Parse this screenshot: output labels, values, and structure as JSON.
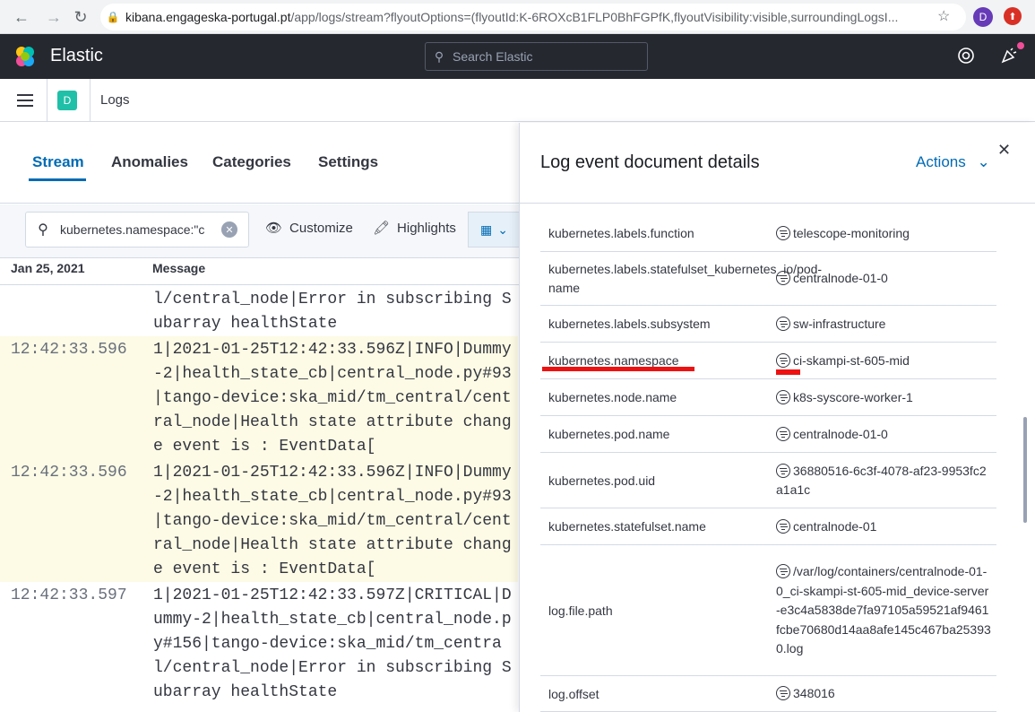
{
  "browser": {
    "url_host": "kibana.engageska-portugal.pt",
    "url_rest": "/app/logs/stream?flyoutOptions=(flyoutId:K-6ROXcB1FLP0BhFGPfK,flyoutVisibility:visible,surroundingLogsI...",
    "profile_initial": "D"
  },
  "header": {
    "brand": "Elastic",
    "search_placeholder": "Search Elastic"
  },
  "appbar": {
    "space_initial": "D",
    "breadcrumb": "Logs"
  },
  "tabs": [
    {
      "label": "Stream",
      "active": true
    },
    {
      "label": "Anomalies"
    },
    {
      "label": "Categories"
    },
    {
      "label": "Settings"
    }
  ],
  "toolbar": {
    "query": "kubernetes.namespace:\"c",
    "customize": "Customize",
    "highlights": "Highlights"
  },
  "columns": {
    "date": "Jan 25, 2021",
    "message": "Message"
  },
  "stream": [
    {
      "ts": "",
      "msg": "l/central_node|Error in subscribing S\nubarray healthState",
      "hl": false
    },
    {
      "ts": "12:42:33.596",
      "msg": "1|2021-01-25T12:42:33.596Z|INFO|Dummy\n-2|health_state_cb|central_node.py#93\n|tango-device:ska_mid/tm_central/cent\nral_node|Health state attribute chang\ne event is : EventData[",
      "hl": true
    },
    {
      "ts": "12:42:33.596",
      "msg": "1|2021-01-25T12:42:33.596Z|INFO|Dummy\n-2|health_state_cb|central_node.py#93\n|tango-device:ska_mid/tm_central/cent\nral_node|Health state attribute chang\ne event is : EventData[",
      "hl": true
    },
    {
      "ts": "12:42:33.597",
      "msg": "1|2021-01-25T12:42:33.597Z|CRITICAL|D\nummy-2|health_state_cb|central_node.p\ny#156|tango-device:ska_mid/tm_centra\nl/central_node|Error in subscribing S\nubarray healthState",
      "hl": false
    }
  ],
  "flyout": {
    "title": "Log event document details",
    "actions": "Actions",
    "fields": [
      {
        "key": "kubernetes.labels.function",
        "value": "telescope-monitoring"
      },
      {
        "key": "kubernetes.labels.statefulset_kubernetes_io/pod-name",
        "value": "centralnode-01-0"
      },
      {
        "key": "kubernetes.labels.subsystem",
        "value": "sw-infrastructure"
      },
      {
        "key": "kubernetes.namespace",
        "value": "ci-skampi-st-605-mid"
      },
      {
        "key": "kubernetes.node.name",
        "value": "k8s-syscore-worker-1"
      },
      {
        "key": "kubernetes.pod.name",
        "value": "centralnode-01-0"
      },
      {
        "key": "kubernetes.pod.uid",
        "value": "36880516-6c3f-4078-af23-9953fc2a1a1c"
      },
      {
        "key": "kubernetes.statefulset.name",
        "value": "centralnode-01"
      },
      {
        "key": "log.file.path",
        "value": "/var/log/containers/centralnode-01-0_ci-skampi-st-605-mid_device-server-e3c4a5838de7fa97105a59521af9461fcbe70680d14aa8afe145c467ba253930.log"
      },
      {
        "key": "log.offset",
        "value": "348016"
      }
    ]
  },
  "colors": {
    "accent": "#006bb4",
    "header_bg": "#25282f",
    "highlight_row": "#fdfbe5",
    "annotation_red": "#ee1111"
  }
}
